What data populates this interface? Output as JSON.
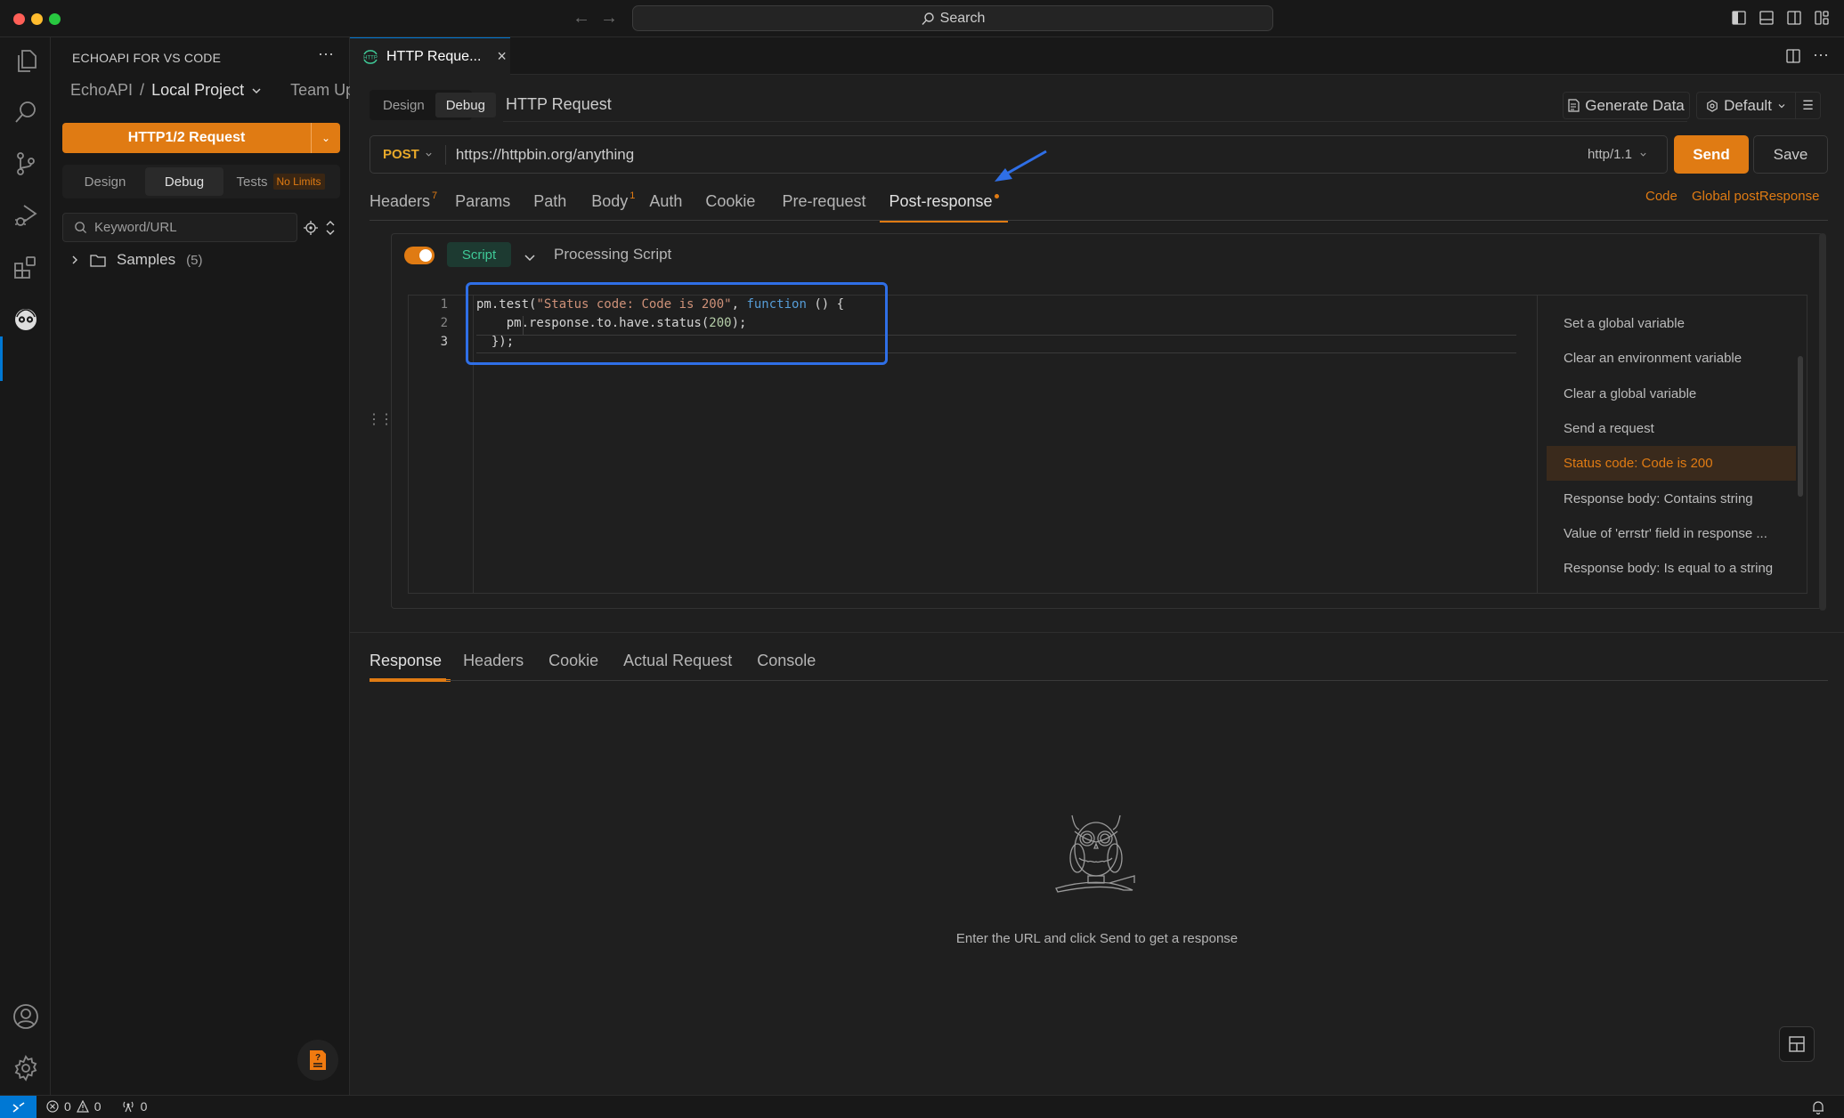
{
  "titlebar": {
    "search_label": "Search",
    "back_icon": "arrow-left-icon",
    "forward_icon": "arrow-right-icon"
  },
  "activity_bar": {
    "items": [
      {
        "name": "explorer",
        "icon": "files-icon"
      },
      {
        "name": "search",
        "icon": "search-icon"
      },
      {
        "name": "source-control",
        "icon": "source-control-icon"
      },
      {
        "name": "run-debug",
        "icon": "run-debug-icon"
      },
      {
        "name": "extensions",
        "icon": "extensions-icon"
      },
      {
        "name": "echoapi",
        "icon": "echoapi-owl-icon",
        "active": true
      }
    ],
    "bottom": [
      {
        "name": "accounts",
        "icon": "account-icon"
      },
      {
        "name": "manage",
        "icon": "gear-icon"
      }
    ]
  },
  "sidebar": {
    "title": "ECHOAPI FOR VS CODE",
    "more_label": "···",
    "breadcrumb": {
      "root": "EchoAPI",
      "separator": "/",
      "project": "Local Project",
      "team": "Team Up"
    },
    "new_request_label": "HTTP1/2 Request",
    "tabs": [
      {
        "label": "Design",
        "active": false
      },
      {
        "label": "Debug",
        "active": true
      },
      {
        "label": "Tests",
        "active": false,
        "badge": "No Limits"
      }
    ],
    "search_placeholder": "Keyword/URL",
    "tree": [
      {
        "label": "Samples",
        "count": "(5)",
        "expanded": false
      }
    ]
  },
  "editor_tab": {
    "icon_text": "HTTP",
    "label": "HTTP Reque...",
    "close": "×"
  },
  "request": {
    "mode_tabs": [
      {
        "label": "Design",
        "active": false
      },
      {
        "label": "Debug",
        "active": true
      }
    ],
    "name": "HTTP Request",
    "generate_data_label": "Generate Data",
    "environment": "Default",
    "method": "POST",
    "url": "https://httpbin.org/anything",
    "protocol": "http/1.1",
    "send_label": "Send",
    "save_label": "Save",
    "tabs": [
      {
        "label": "Headers",
        "count": "7"
      },
      {
        "label": "Params"
      },
      {
        "label": "Path"
      },
      {
        "label": "Body",
        "count": "1"
      },
      {
        "label": "Auth"
      },
      {
        "label": "Cookie"
      },
      {
        "label": "Pre-request"
      },
      {
        "label": "Post-response",
        "active": true,
        "modified": true
      }
    ],
    "code_link": "Code",
    "global_link": "Global postResponse"
  },
  "script": {
    "enabled": true,
    "type_label": "Script",
    "title": "Processing Script",
    "lines": [
      {
        "n": "1",
        "tokens": [
          [
            "plain",
            "pm.test("
          ],
          [
            "str",
            "\"Status code: Code is 200\""
          ],
          [
            "plain",
            ", "
          ],
          [
            "kw",
            "function"
          ],
          [
            "plain",
            " () {"
          ]
        ]
      },
      {
        "n": "2",
        "tokens": [
          [
            "plain",
            "    pm.response.to.have.status("
          ],
          [
            "num",
            "200"
          ],
          [
            "plain",
            ");"
          ]
        ]
      },
      {
        "n": "3",
        "tokens": [
          [
            "plain",
            "  });"
          ]
        ]
      }
    ],
    "current_line": "3",
    "snippets": [
      {
        "label": "Set a global variable"
      },
      {
        "label": "Clear an environment variable"
      },
      {
        "label": "Clear a global variable"
      },
      {
        "label": "Send a request"
      },
      {
        "label": "Status code: Code is 200",
        "active": true
      },
      {
        "label": "Response body: Contains string"
      },
      {
        "label": "Value of 'errstr' field in response ..."
      },
      {
        "label": "Response body: Is equal to a string"
      }
    ]
  },
  "response": {
    "tabs": [
      {
        "label": "Response",
        "active": true
      },
      {
        "label": "Headers"
      },
      {
        "label": "Cookie"
      },
      {
        "label": "Actual Request"
      },
      {
        "label": "Console"
      }
    ],
    "empty_message": "Enter the URL and click Send to get a response"
  },
  "statusbar": {
    "errors": "0",
    "warnings": "0",
    "ports": "0"
  },
  "colors": {
    "accent": "#e07b13",
    "annotation_blue": "#2f6fe6",
    "vscode_blue": "#0078d4",
    "script_green": "#3fc997"
  }
}
